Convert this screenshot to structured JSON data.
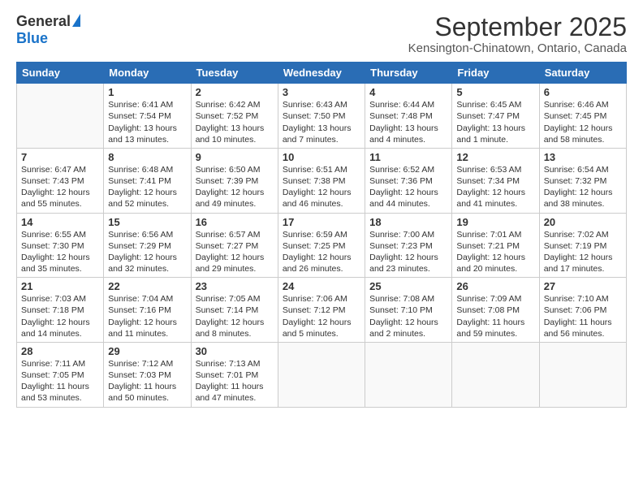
{
  "logo": {
    "general": "General",
    "blue": "Blue"
  },
  "title": "September 2025",
  "subtitle": "Kensington-Chinatown, Ontario, Canada",
  "days_header": [
    "Sunday",
    "Monday",
    "Tuesday",
    "Wednesday",
    "Thursday",
    "Friday",
    "Saturday"
  ],
  "weeks": [
    [
      {
        "day": "",
        "info": ""
      },
      {
        "day": "1",
        "info": "Sunrise: 6:41 AM\nSunset: 7:54 PM\nDaylight: 13 hours\nand 13 minutes."
      },
      {
        "day": "2",
        "info": "Sunrise: 6:42 AM\nSunset: 7:52 PM\nDaylight: 13 hours\nand 10 minutes."
      },
      {
        "day": "3",
        "info": "Sunrise: 6:43 AM\nSunset: 7:50 PM\nDaylight: 13 hours\nand 7 minutes."
      },
      {
        "day": "4",
        "info": "Sunrise: 6:44 AM\nSunset: 7:48 PM\nDaylight: 13 hours\nand 4 minutes."
      },
      {
        "day": "5",
        "info": "Sunrise: 6:45 AM\nSunset: 7:47 PM\nDaylight: 13 hours\nand 1 minute."
      },
      {
        "day": "6",
        "info": "Sunrise: 6:46 AM\nSunset: 7:45 PM\nDaylight: 12 hours\nand 58 minutes."
      }
    ],
    [
      {
        "day": "7",
        "info": "Sunrise: 6:47 AM\nSunset: 7:43 PM\nDaylight: 12 hours\nand 55 minutes."
      },
      {
        "day": "8",
        "info": "Sunrise: 6:48 AM\nSunset: 7:41 PM\nDaylight: 12 hours\nand 52 minutes."
      },
      {
        "day": "9",
        "info": "Sunrise: 6:50 AM\nSunset: 7:39 PM\nDaylight: 12 hours\nand 49 minutes."
      },
      {
        "day": "10",
        "info": "Sunrise: 6:51 AM\nSunset: 7:38 PM\nDaylight: 12 hours\nand 46 minutes."
      },
      {
        "day": "11",
        "info": "Sunrise: 6:52 AM\nSunset: 7:36 PM\nDaylight: 12 hours\nand 44 minutes."
      },
      {
        "day": "12",
        "info": "Sunrise: 6:53 AM\nSunset: 7:34 PM\nDaylight: 12 hours\nand 41 minutes."
      },
      {
        "day": "13",
        "info": "Sunrise: 6:54 AM\nSunset: 7:32 PM\nDaylight: 12 hours\nand 38 minutes."
      }
    ],
    [
      {
        "day": "14",
        "info": "Sunrise: 6:55 AM\nSunset: 7:30 PM\nDaylight: 12 hours\nand 35 minutes."
      },
      {
        "day": "15",
        "info": "Sunrise: 6:56 AM\nSunset: 7:29 PM\nDaylight: 12 hours\nand 32 minutes."
      },
      {
        "day": "16",
        "info": "Sunrise: 6:57 AM\nSunset: 7:27 PM\nDaylight: 12 hours\nand 29 minutes."
      },
      {
        "day": "17",
        "info": "Sunrise: 6:59 AM\nSunset: 7:25 PM\nDaylight: 12 hours\nand 26 minutes."
      },
      {
        "day": "18",
        "info": "Sunrise: 7:00 AM\nSunset: 7:23 PM\nDaylight: 12 hours\nand 23 minutes."
      },
      {
        "day": "19",
        "info": "Sunrise: 7:01 AM\nSunset: 7:21 PM\nDaylight: 12 hours\nand 20 minutes."
      },
      {
        "day": "20",
        "info": "Sunrise: 7:02 AM\nSunset: 7:19 PM\nDaylight: 12 hours\nand 17 minutes."
      }
    ],
    [
      {
        "day": "21",
        "info": "Sunrise: 7:03 AM\nSunset: 7:18 PM\nDaylight: 12 hours\nand 14 minutes."
      },
      {
        "day": "22",
        "info": "Sunrise: 7:04 AM\nSunset: 7:16 PM\nDaylight: 12 hours\nand 11 minutes."
      },
      {
        "day": "23",
        "info": "Sunrise: 7:05 AM\nSunset: 7:14 PM\nDaylight: 12 hours\nand 8 minutes."
      },
      {
        "day": "24",
        "info": "Sunrise: 7:06 AM\nSunset: 7:12 PM\nDaylight: 12 hours\nand 5 minutes."
      },
      {
        "day": "25",
        "info": "Sunrise: 7:08 AM\nSunset: 7:10 PM\nDaylight: 12 hours\nand 2 minutes."
      },
      {
        "day": "26",
        "info": "Sunrise: 7:09 AM\nSunset: 7:08 PM\nDaylight: 11 hours\nand 59 minutes."
      },
      {
        "day": "27",
        "info": "Sunrise: 7:10 AM\nSunset: 7:06 PM\nDaylight: 11 hours\nand 56 minutes."
      }
    ],
    [
      {
        "day": "28",
        "info": "Sunrise: 7:11 AM\nSunset: 7:05 PM\nDaylight: 11 hours\nand 53 minutes."
      },
      {
        "day": "29",
        "info": "Sunrise: 7:12 AM\nSunset: 7:03 PM\nDaylight: 11 hours\nand 50 minutes."
      },
      {
        "day": "30",
        "info": "Sunrise: 7:13 AM\nSunset: 7:01 PM\nDaylight: 11 hours\nand 47 minutes."
      },
      {
        "day": "",
        "info": ""
      },
      {
        "day": "",
        "info": ""
      },
      {
        "day": "",
        "info": ""
      },
      {
        "day": "",
        "info": ""
      }
    ]
  ]
}
